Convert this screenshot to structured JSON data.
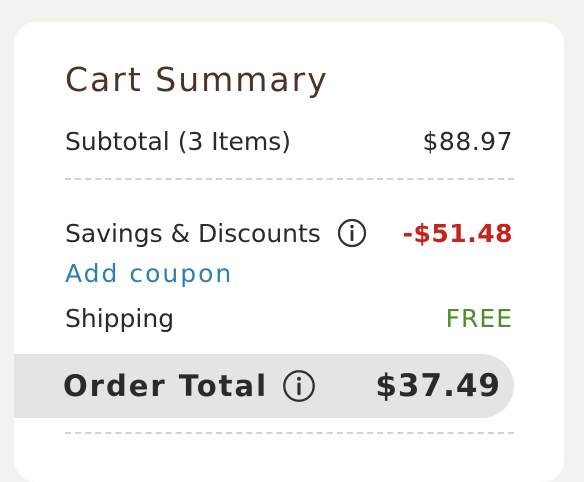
{
  "summary": {
    "title": "Cart Summary",
    "subtotal": {
      "label": "Subtotal (3 Items)",
      "value": "$88.97"
    },
    "savings": {
      "label": "Savings & Discounts",
      "value": "-$51.48",
      "icon": "info-icon"
    },
    "coupon_link": "Add coupon",
    "shipping": {
      "label": "Shipping",
      "value": "FREE"
    },
    "order_total": {
      "label": "Order Total",
      "value": "$37.49",
      "icon": "info-icon"
    }
  },
  "colors": {
    "title": "#4b3328",
    "savings": "#c5231b",
    "free_shipping": "#4f8a2e",
    "link": "#2f7fb0",
    "total_bar": "#e6e4e0"
  }
}
